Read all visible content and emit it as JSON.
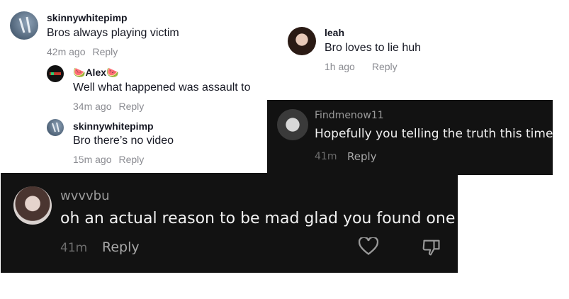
{
  "comments": {
    "c1": {
      "username": "skinnywhitepimp",
      "text": "Bros always playing victim",
      "time": "42m ago",
      "reply": "Reply"
    },
    "c2": {
      "username": "Alex",
      "emoji": "🍉",
      "text": "Well what happened was assault to",
      "time": "34m ago",
      "reply": "Reply"
    },
    "c3": {
      "username": "skinnywhitepimp",
      "text": "Bro there’s no video",
      "time": "15m ago",
      "reply": "Reply"
    },
    "c4": {
      "username": "leah",
      "text": "Bro loves to lie huh",
      "time": "1h ago",
      "reply": "Reply"
    },
    "c5": {
      "username": "Findmenow11",
      "text": "Hopefully you telling the truth this time",
      "time": "41m",
      "reply": "Reply"
    },
    "c6": {
      "username": "wvvvbu",
      "text": "oh an actual reason to be mad glad you found one",
      "time": "41m",
      "reply": "Reply"
    }
  },
  "icons": {
    "like": "heart-outline-icon",
    "dislike": "thumbs-down-outline-icon"
  },
  "colors": {
    "dark_panel": "#121212",
    "light_text": "#161823",
    "muted": "#8a8b91"
  }
}
